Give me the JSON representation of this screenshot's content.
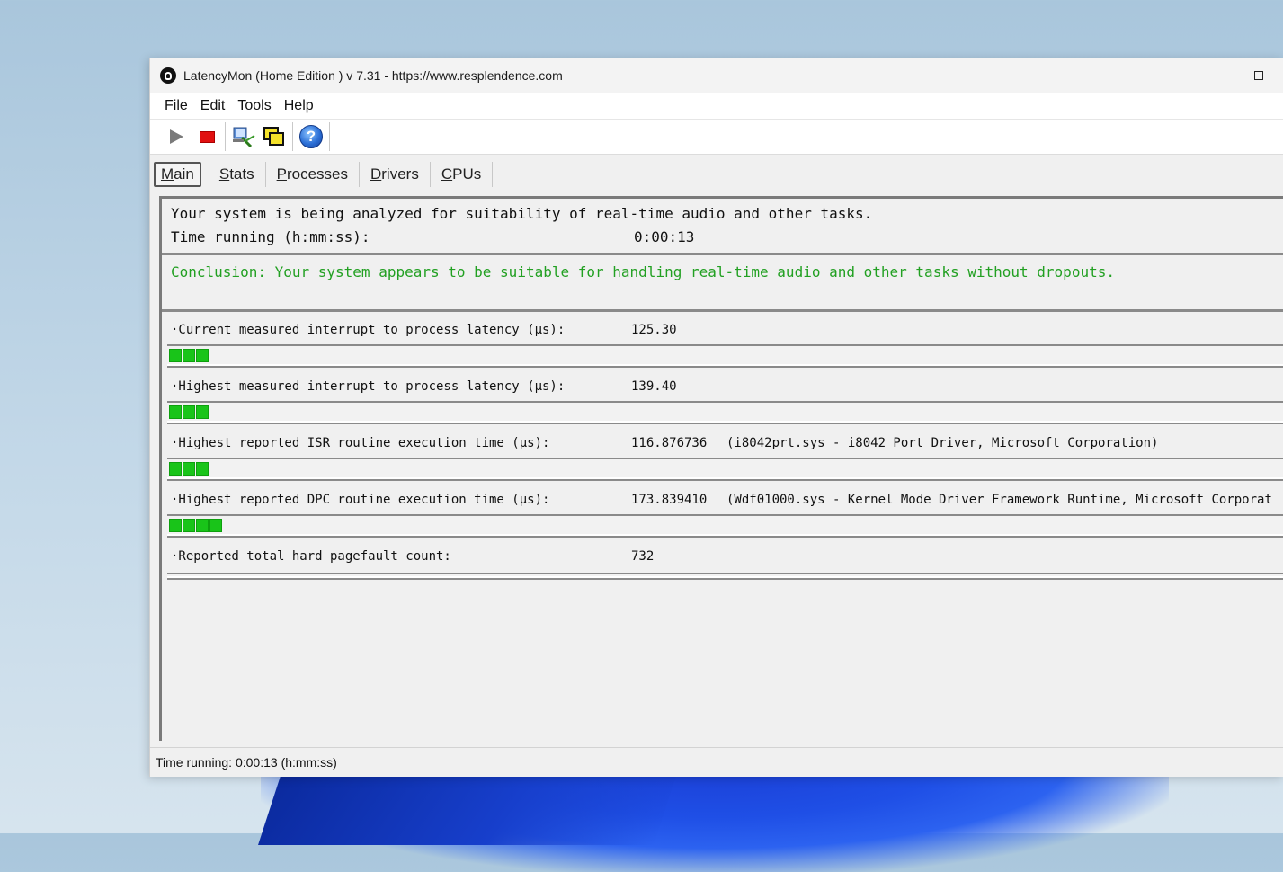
{
  "window": {
    "title": "LatencyMon  (Home Edition )  v 7.31 - https://www.resplendence.com"
  },
  "menu": [
    {
      "label": "File",
      "key": "F",
      "rest": "ile"
    },
    {
      "label": "Edit",
      "key": "E",
      "rest": "dit"
    },
    {
      "label": "Tools",
      "key": "T",
      "rest": "ools"
    },
    {
      "label": "Help",
      "key": "H",
      "rest": "elp"
    }
  ],
  "toolbar": {
    "icons": [
      "play-icon",
      "stop-icon",
      "drivers-search-icon",
      "windows-icon",
      "help-icon"
    ],
    "help_glyph": "?"
  },
  "tabs": [
    {
      "label": "Main",
      "key": "M",
      "rest": "ain"
    },
    {
      "label": "Stats",
      "key": "S",
      "rest": "tats"
    },
    {
      "label": "Processes",
      "key": "P",
      "rest": "rocesses"
    },
    {
      "label": "Drivers",
      "key": "D",
      "rest": "rivers"
    },
    {
      "label": "CPUs",
      "key": "C",
      "rest": "PUs"
    }
  ],
  "analysis": {
    "line1": "Your system is being analyzed for suitability of real-time audio and other tasks.",
    "time_label": "Time running (h:mm:ss):",
    "time_value": "0:00:13"
  },
  "conclusion": "Conclusion: Your system appears to be suitable for handling real-time audio and other tasks without dropouts.",
  "metrics": [
    {
      "label": "·Current measured interrupt to process latency (µs):",
      "value": "125.30",
      "extra": "",
      "bar_segments": 3
    },
    {
      "label": "·Highest measured interrupt to process latency (µs):",
      "value": "139.40",
      "extra": "",
      "bar_segments": 3
    },
    {
      "label": "·Highest reported ISR routine execution time (µs):",
      "value": "116.876736",
      "extra": "(i8042prt.sys - i8042 Port Driver, Microsoft Corporation)",
      "bar_segments": 3
    },
    {
      "label": "·Highest reported DPC routine execution time (µs):",
      "value": "173.839410",
      "extra": "(Wdf01000.sys - Kernel Mode Driver Framework Runtime, Microsoft Corporat",
      "bar_segments": 4
    },
    {
      "label": "·Reported total hard pagefault count:",
      "value": "732",
      "extra": "",
      "bar_segments": 0
    }
  ],
  "status": "Time running: 0:00:13  (h:mm:ss)",
  "colors": {
    "bar_green": "#19c419",
    "conclusion_green": "#22a022",
    "stop_red": "#e11010"
  }
}
